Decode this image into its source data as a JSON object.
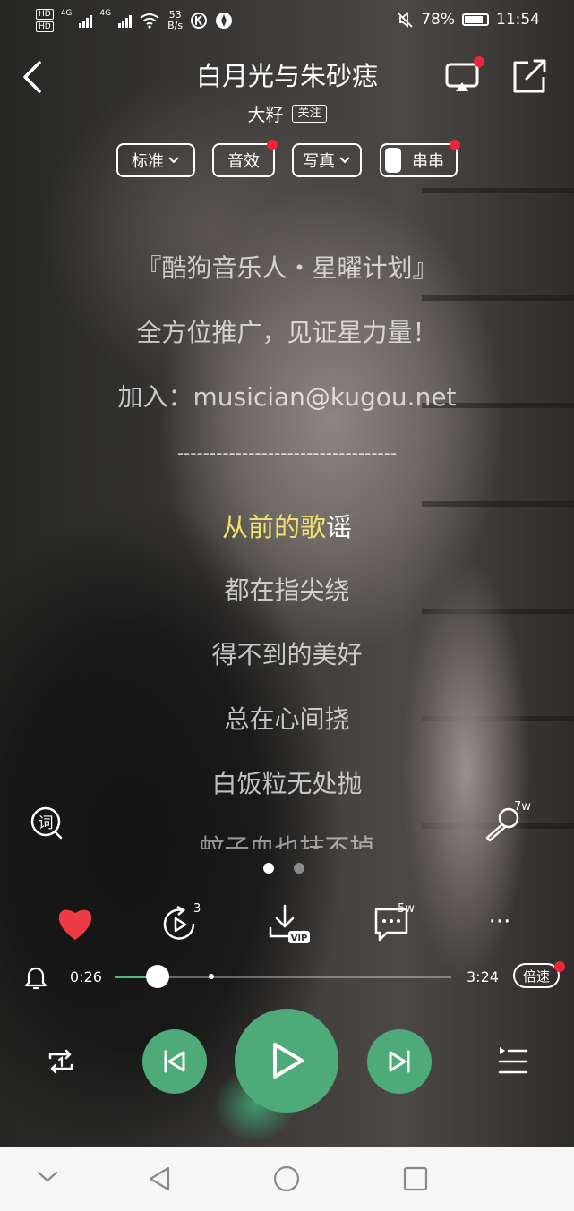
{
  "status_bar": {
    "network_labels": [
      "HD",
      "HD"
    ],
    "signal_1": "4G",
    "signal_2": "4G",
    "speed_value": "53",
    "speed_unit": "B/s",
    "battery": "78%",
    "time": "11:54"
  },
  "header": {
    "title": "白月光与朱砂痣",
    "artist": "大籽",
    "follow_label": "关注"
  },
  "pills": {
    "quality": "标准",
    "effects": "音效",
    "photo": "写真",
    "chain": "串串"
  },
  "lyrics": [
    "『酷狗音乐人・星曜计划』",
    "全方位推广，见证星力量！",
    "加入：musician@kugou.net",
    "----------------------------------"
  ],
  "current_lyric": {
    "sung": "从前的歌",
    "unsung": "谣"
  },
  "upcoming_lyrics": [
    "都在指尖绕",
    "得不到的美好",
    "总在心间挠",
    "白饭粒无处抛",
    "蚊子血也抹不掉"
  ],
  "side": {
    "lyrics_icon_label": "词",
    "karaoke_count": "7w"
  },
  "actions": {
    "share_count": "3",
    "download_badge": "VIP",
    "comment_count": "5w",
    "more": "···"
  },
  "progress": {
    "current": "0:26",
    "total": "3:24",
    "fraction": 0.127,
    "speed_label": "倍速"
  },
  "colors": {
    "accent": "#4faa7a",
    "highlight": "#f0df6a",
    "heart": "#ef3b45",
    "dot": "#f0243a"
  }
}
